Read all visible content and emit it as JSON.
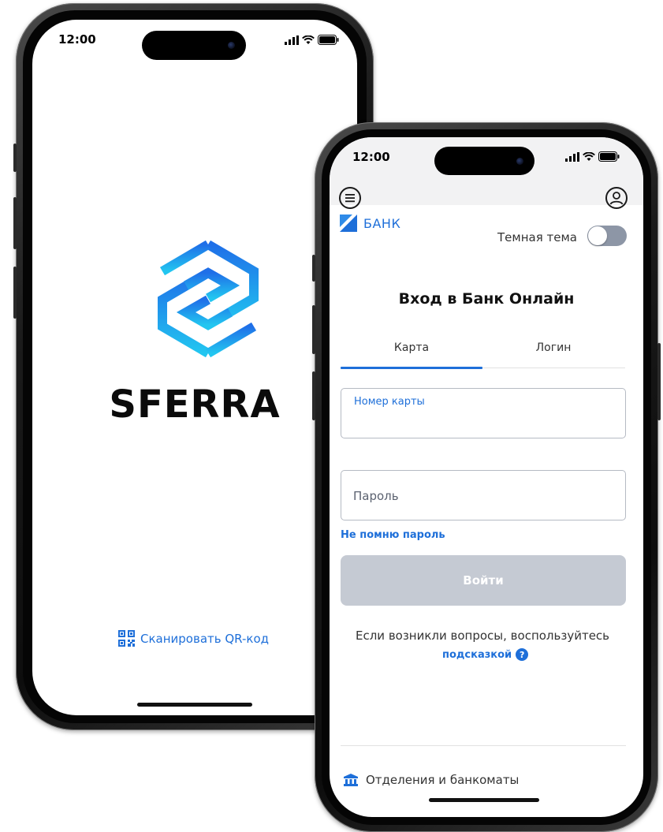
{
  "phone_splash": {
    "status_time": "12:00",
    "brand_name": "SFERRA",
    "qr_label": "Сканировать QR-код",
    "accent": "#1e6fd9"
  },
  "phone_login": {
    "status_time": "12:00",
    "bank_name": "БАНК",
    "dark_theme_label": "Темная тема",
    "dark_theme_on": false,
    "title": "Вход в Банк Онлайн",
    "tabs": [
      {
        "label": "Карта",
        "active": true
      },
      {
        "label": "Логин",
        "active": false
      }
    ],
    "card_field": {
      "label": "Номер карты",
      "value": ""
    },
    "password_field": {
      "placeholder": "Пароль",
      "value": ""
    },
    "forgot_password": "Не помню пароль",
    "submit_label": "Войти",
    "help_text": "Если возникли вопросы, воспользуйтесь",
    "help_link": "подсказкой",
    "help_icon": "?",
    "branches_label": "Отделения и банкоматы",
    "colors": {
      "accent": "#1e6fd9",
      "button_disabled": "#c5cad3",
      "toggle_off": "#8d96a6"
    }
  }
}
